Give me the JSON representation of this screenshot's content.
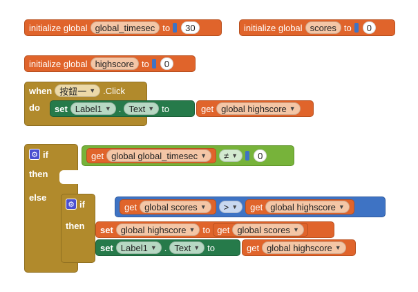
{
  "globals": [
    {
      "init": "initialize global",
      "name": "global_timesec",
      "to": "to",
      "value": "30"
    },
    {
      "init": "initialize global",
      "name": "scores",
      "to": "to",
      "value": "0"
    },
    {
      "init": "initialize global",
      "name": "highscore",
      "to": "to",
      "value": "0"
    }
  ],
  "event": {
    "when": "when",
    "component": "按鈕一",
    "event": ".Click",
    "do": "do",
    "set": "set",
    "target": "Label1",
    "dot": ".",
    "prop": "Text",
    "to": "to",
    "get": "get",
    "var": "global highscore"
  },
  "if_block": {
    "if": "if",
    "then": "then",
    "else": "else",
    "get": "get",
    "var": "global global_timesec",
    "op": "≠",
    "value": "0",
    "inner_if": {
      "if": "if",
      "then": "then",
      "get_left": "get",
      "var_left": "global scores",
      "op": ">",
      "get_right": "get",
      "var_right": "global highscore",
      "set1": {
        "set": "set",
        "var": "global highscore",
        "to": "to",
        "get": "get",
        "value": "global scores"
      },
      "set2": {
        "set": "set",
        "target": "Label1",
        "dot": ".",
        "prop": "Text",
        "to": "to",
        "get": "get",
        "value": "global highscore"
      }
    }
  }
}
